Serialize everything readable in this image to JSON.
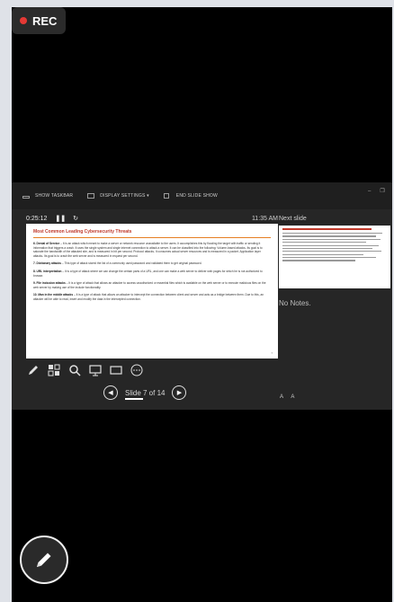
{
  "recording": {
    "label": "REC"
  },
  "toolbar": {
    "show_taskbar": "SHOW TASKBAR",
    "display_settings": "DISPLAY SETTINGS ▾",
    "end_slide_show": "END SLIDE SHOW"
  },
  "presenter": {
    "elapsed": "0:25:12",
    "clock": "11:35 AM",
    "next_slide_label": "Next slide",
    "notes_text": "No Notes.",
    "counter": "Slide 7 of 14",
    "font_increase": "A",
    "font_decrease": "A"
  },
  "slide": {
    "title": "Most Common Leading Cybersecurity Threats",
    "paragraphs": [
      {
        "head": "6. Denial of Service",
        "body": " – It is an attack which meant to make a server or network resource unavailable to the users. It accomplishes this by flooding the target with traffic or sending it information that triggers a crash. It uses the single system and single internet connection to attack a server. It can be classified into the following: Volume-based attacks- Its goal is to saturate the bandwidth of the attacked site, and is measured in bit per second. Protocol attacks- It consumes actual server resources and is measured in a packet. Application layer attacks- Its goal is to crash the web server and is measured in request per second."
      },
      {
        "head": "7. Dictionary attacks",
        "body": " – This type of attack stored the list of a commonly used password and validated them to get original password."
      },
      {
        "head": "8. URL interpretation",
        "body": " – It is a type of attack where we can change the certain parts of a URL, and one can make a web server to deliver web pages for which he is not authorized to browse."
      },
      {
        "head": "9. File inclusion attacks",
        "body": " – It is a type of attack that allows an attacker to access unauthorized or essential files which is available on the web server or to execute malicious files on the web server by making use of the include functionality."
      },
      {
        "head": "10. Man in the middle attacks",
        "body": " – It is a type of attack that allows an attacker to intercept the connection between client and server and acts as a bridge between them. Due to this, an attacker will be able to read, insert and modify the data in the intercepted connection."
      }
    ],
    "page_number": "7"
  },
  "icons": {
    "pen": "pen-icon",
    "multi_slide": "slides-grid-icon",
    "zoom": "magnifier-icon",
    "pointer": "screen-pointer-icon",
    "black_screen": "black-screen-icon",
    "more": "more-icon",
    "prev": "prev-icon",
    "next": "next-icon",
    "annotate": "annotate-pen-icon"
  },
  "colors": {
    "rec_dot": "#e53935",
    "slide_title": "#c0392b",
    "slide_rule": "#e67e22"
  }
}
